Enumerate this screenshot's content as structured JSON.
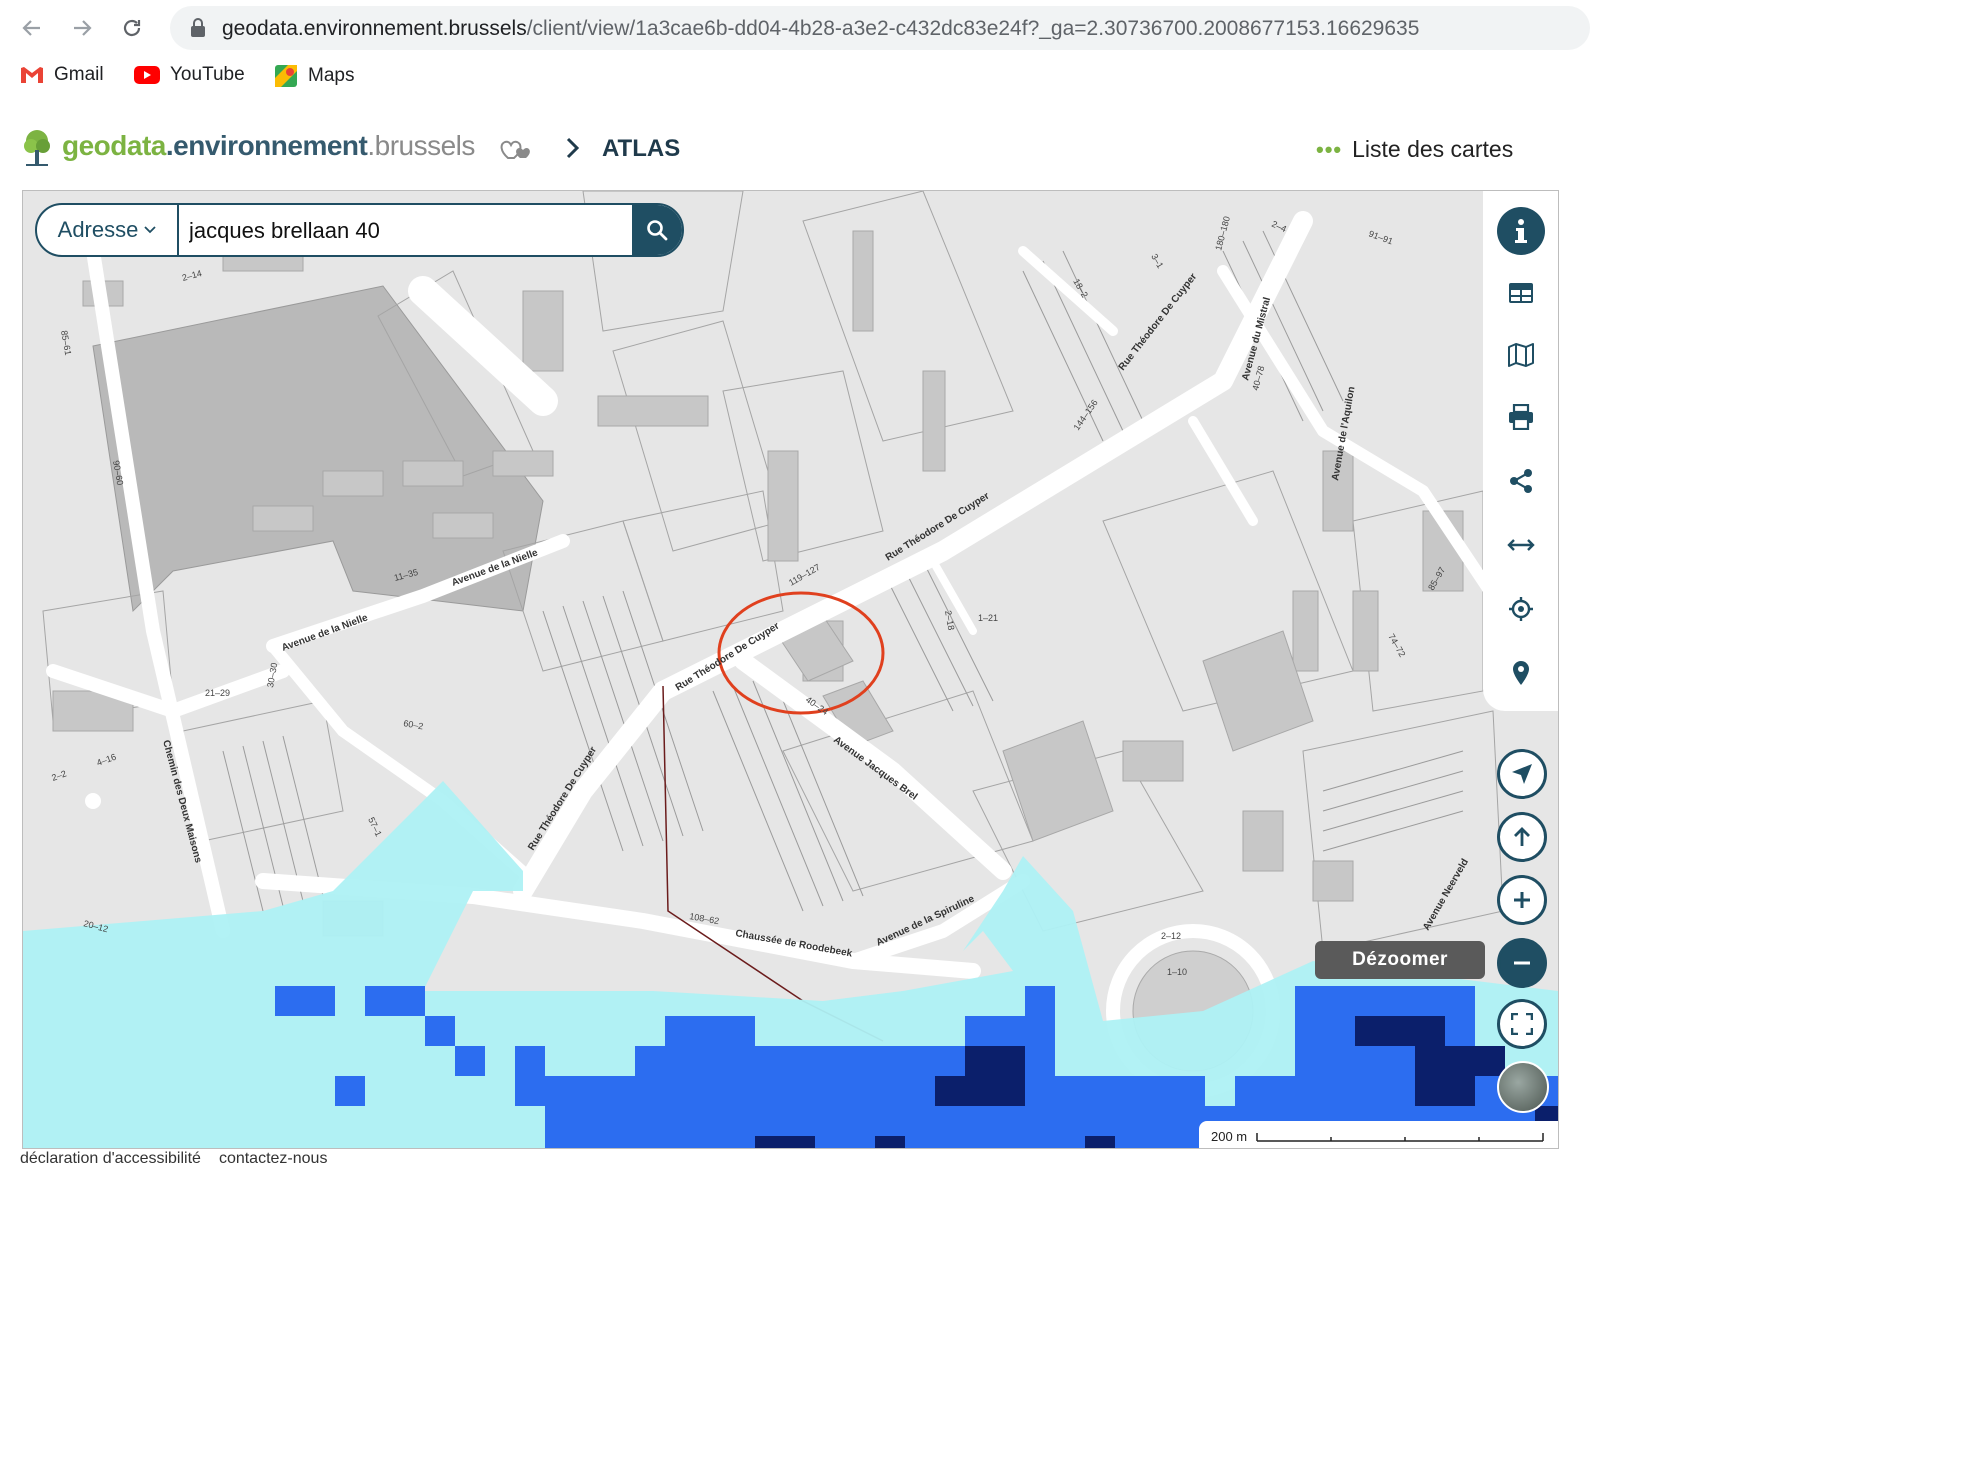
{
  "browser": {
    "url_host": "geodata.environnement.brussels",
    "url_path": "/client/view/1a3cae6b-dd04-4b28-a3e2-c432dc83e24f?_ga=2.30736700.2008677153.16629635",
    "bookmarks": [
      {
        "label": "Gmail",
        "icon": "gmail-icon"
      },
      {
        "label": "YouTube",
        "icon": "youtube-icon"
      },
      {
        "label": "Maps",
        "icon": "maps-icon"
      }
    ]
  },
  "header": {
    "logo_part1": "geodata",
    "logo_part2": ".environnement",
    "logo_part3": ".brussels",
    "breadcrumb": "ATLAS",
    "map_list_label": "Liste des cartes",
    "accent": "#7cb342",
    "brand": "#1f4e63"
  },
  "search": {
    "type_label": "Adresse",
    "query": "jacques brellaan 40"
  },
  "map": {
    "tooltip": "Dézoomer",
    "scale_label": "200 m",
    "streets": [
      "Rue Théodore De Cuyper",
      "Rue Théodore De Cuyper",
      "Rue Théodore De Cuyper",
      "Rue Théodore De Cuyper",
      "Avenue Jacques Brel",
      "Avenue de la Nielle",
      "Avenue de la Nielle",
      "Chaussée de Roodebeek",
      "Avenue de la Spiruline",
      "Chemin des Deux Maisons",
      "Avenue du Mistral",
      "Avenue de l'Aquilon",
      "Avenue Neerveld"
    ],
    "house_numbers": [
      "119–127",
      "144–156",
      "40–78",
      "11–35",
      "21–29",
      "30–30",
      "60–2",
      "57–1",
      "2–18",
      "1–21",
      "40–24",
      "108–62",
      "2–12",
      "1–10",
      "85–97",
      "74–72",
      "2–14",
      "85–61",
      "90–60",
      "4–16",
      "2–2",
      "20–12",
      "180–180",
      "2–4",
      "91–91",
      "18–2",
      "3–1"
    ]
  },
  "footer": {
    "accessibility": "déclaration d'accessibilité",
    "contact": "contactez-nous"
  }
}
